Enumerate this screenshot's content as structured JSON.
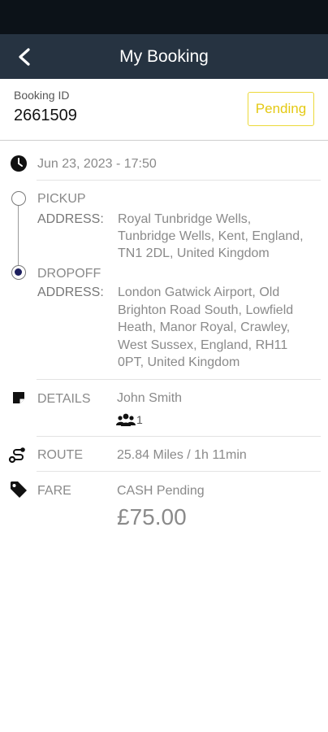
{
  "app_bar": {
    "title": "My Booking"
  },
  "booking": {
    "id_label": "Booking ID",
    "id_value": "2661509",
    "status": "Pending"
  },
  "datetime": "Jun 23, 2023 - 17:50",
  "pickup": {
    "heading": "PICKUP",
    "address_label": "ADDRESS:",
    "address_lines": [
      "Royal Tunbridge Wells,",
      "Tunbridge Wells, Kent, England,",
      "TN1 2DL, United Kingdom"
    ]
  },
  "dropoff": {
    "heading": "DROPOFF",
    "address_label": "ADDRESS:",
    "address_lines": [
      "London Gatwick Airport, Old",
      "Brighton Road South, Lowfield",
      "Heath, Manor Royal, Crawley,",
      "West Sussex, England, RH11",
      "0PT, United Kingdom"
    ]
  },
  "details": {
    "label": "DETAILS",
    "name": "John Smith",
    "passengers": "1"
  },
  "route": {
    "label": "ROUTE",
    "value": "25.84 Miles / 1h 11min"
  },
  "fare": {
    "label": "FARE",
    "payment": "CASH Pending",
    "amount": "£75.00"
  },
  "colors": {
    "app_bar": "#263341",
    "status_bar": "#0c1218",
    "pending": "#e4c913",
    "dropoff_dot": "#1d1f5e"
  },
  "icons": [
    "back-arrow-icon",
    "clock-icon",
    "note-icon",
    "people-icon",
    "route-icon",
    "tag-icon"
  ]
}
